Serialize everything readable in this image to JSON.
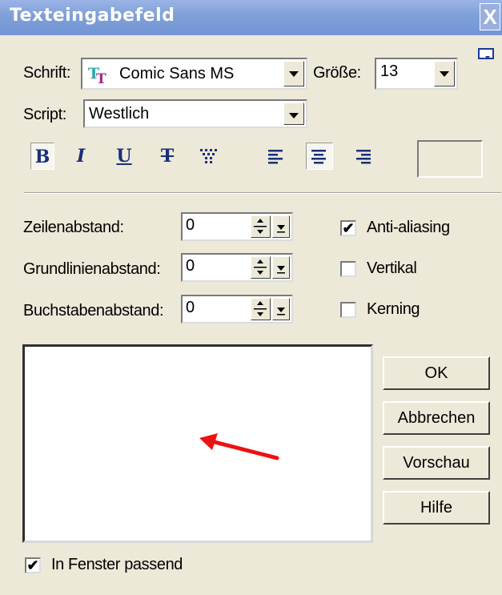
{
  "window": {
    "title": "Texteingabefeld",
    "close_glyph": "X"
  },
  "font": {
    "label": "Schrift:",
    "value": "Comic Sans MS",
    "icon": "truetype-font-icon"
  },
  "size": {
    "label": "Größe:",
    "value": "13"
  },
  "script": {
    "label": "Script:",
    "value": "Westlich"
  },
  "toolbar": {
    "bold": "B",
    "italic": "I",
    "underline": "U",
    "strike": "T"
  },
  "spacing": {
    "line": {
      "label": "Zeilenabstand:",
      "value": "0"
    },
    "baseline": {
      "label": "Grundlinienabstand:",
      "value": "0"
    },
    "letter": {
      "label": "Buchstabenabstand:",
      "value": "0"
    }
  },
  "options": {
    "antialias": {
      "label": "Anti-aliasing",
      "checked": true
    },
    "vertical": {
      "label": "Vertikal",
      "checked": false
    },
    "kerning": {
      "label": "Kerning",
      "checked": false
    }
  },
  "buttons": {
    "ok": "OK",
    "cancel": "Abbrechen",
    "preview": "Vorschau",
    "help": "Hilfe"
  },
  "fit": {
    "label": "In Fenster passend",
    "checked": true
  },
  "colors": {
    "annotation_arrow": "#ee1111",
    "title_bar": "#7f9fd8"
  }
}
